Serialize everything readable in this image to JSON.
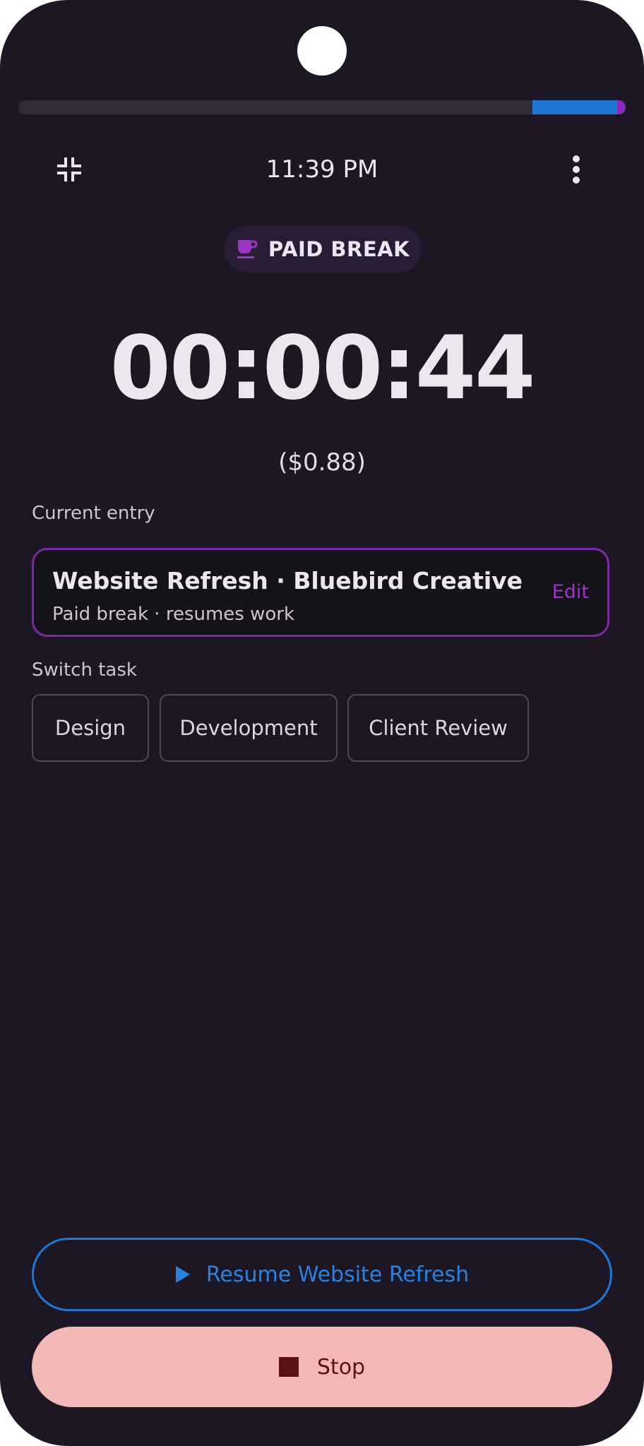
{
  "status_bar": {
    "progress_fraction": 0.14
  },
  "header": {
    "time": "11:39 PM",
    "collapse_icon": "collapse-icon",
    "more_icon": "more-vert-icon"
  },
  "mode_chip": {
    "icon": "coffee-cup-icon",
    "label": "PAID BREAK"
  },
  "timer": {
    "elapsed": "00:00:44",
    "earnings": "($0.88)"
  },
  "current_entry": {
    "section_label": "Current entry",
    "title": "Website Refresh · Bluebird Creative",
    "subtitle": "Paid break · resumes work",
    "edit_label": "Edit"
  },
  "switch_task": {
    "section_label": "Switch task",
    "tasks": [
      "Design",
      "Development",
      "Client Review"
    ]
  },
  "actions": {
    "resume_label": "Resume Website Refresh",
    "resume_icon": "play-icon",
    "stop_label": "Stop",
    "stop_icon": "stop-icon"
  },
  "colors": {
    "background": "#1d1624",
    "accent_purple": "#8a2bbd",
    "accent_blue": "#1f78d6",
    "stop_bg": "#f2b8b8",
    "stop_text": "#5c1212"
  }
}
